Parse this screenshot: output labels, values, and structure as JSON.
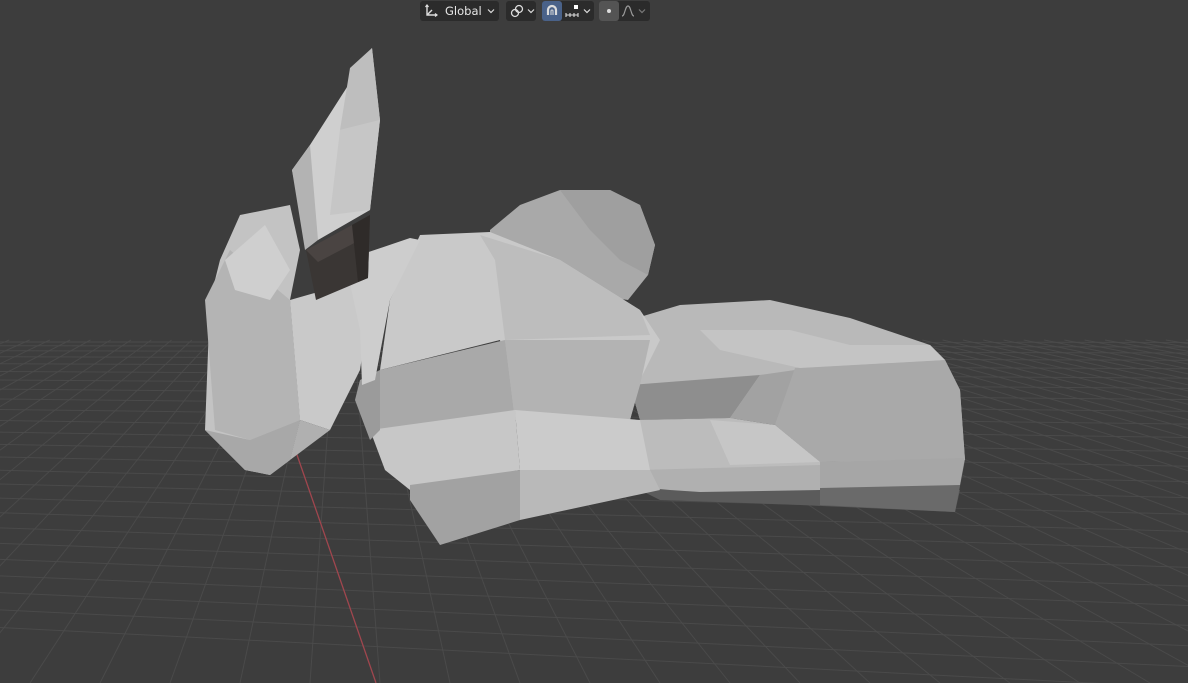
{
  "header": {
    "transform_orientation": {
      "label": "Global",
      "icon": "orientation-axes-icon"
    },
    "pivot_point": {
      "icon": "pivot-link-icon"
    },
    "snap_toggle": {
      "icon": "magnet-icon",
      "active": true
    },
    "snap_target": {
      "icon": "snap-increment-icon"
    },
    "proportional_editing": {
      "icon": "proportional-edit-icon"
    },
    "falloff": {
      "icon": "falloff-curve-icon"
    }
  },
  "scene": {
    "background_color": "#3d3d3d",
    "grid_color": "#4a4a4a",
    "x_axis_color": "#a0464e",
    "mesh_color": "#b8b8b8"
  }
}
